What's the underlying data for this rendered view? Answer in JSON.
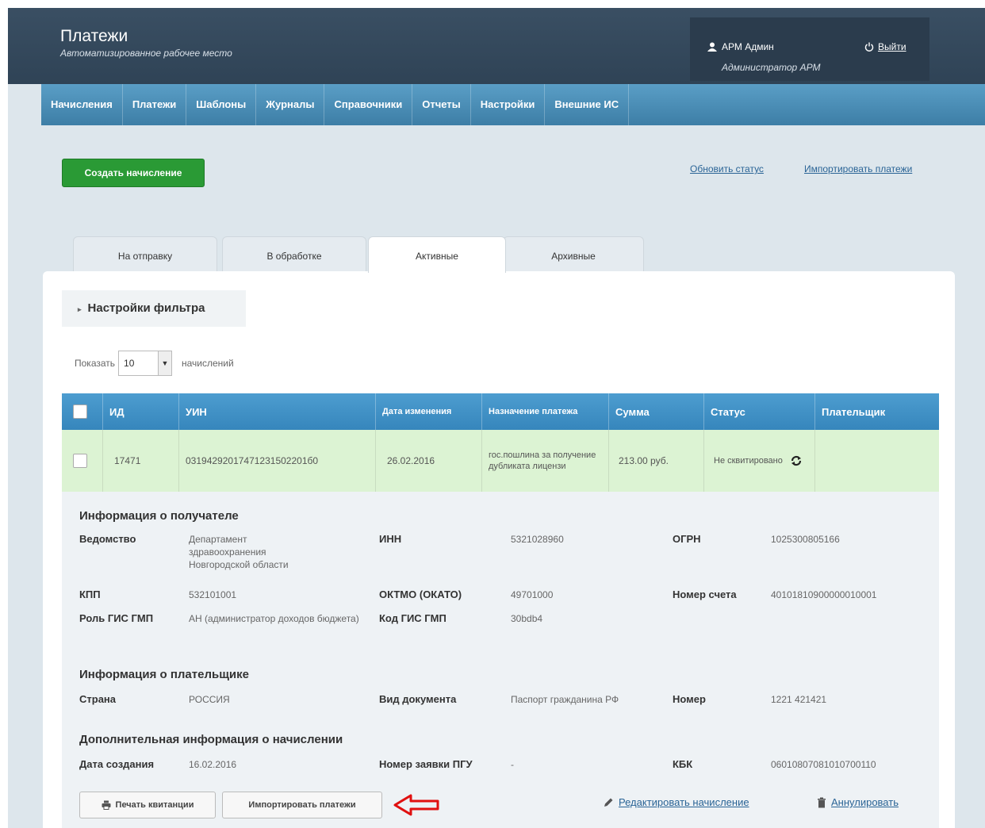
{
  "header": {
    "title": "Платежи",
    "subtitle": "Автоматизированное рабочее место",
    "user_name": "АРМ Админ",
    "user_role": "Администратор АРМ",
    "logout_label": "Выйти"
  },
  "nav": [
    "Начисления",
    "Платежи",
    "Шаблоны",
    "Журналы",
    "Справочники",
    "Отчеты",
    "Настройки",
    "Внешние ИС"
  ],
  "toolbar": {
    "create_label": "Создать начисление",
    "refresh_status_label": "Обновить статус",
    "import_payments_label": "Импортировать платежи"
  },
  "tabs": [
    {
      "label": "На отправку",
      "active": false
    },
    {
      "label": "В обработке",
      "active": false
    },
    {
      "label": "Активные",
      "active": true
    },
    {
      "label": "Архивные",
      "active": false
    }
  ],
  "filter": {
    "label": "Настройки фильтра"
  },
  "page_size": {
    "prefix": "Показать",
    "value": "10",
    "suffix": "начислений"
  },
  "table": {
    "columns": [
      "ИД",
      "УИН",
      "Дата изменения",
      "Назначение платежа",
      "Сумма",
      "Статус",
      "Плательщик"
    ],
    "rows": [
      {
        "id": "17471",
        "uin": "03194292017471231502201б0",
        "date": "26.02.2016",
        "purpose": "гос.пошлина за получение дубликата лицензи",
        "amount": "213.00 руб.",
        "status": "Не сквитировано",
        "payer": ""
      }
    ]
  },
  "recipient": {
    "title": "Информация о получателе",
    "labels": {
      "department": "Ведомство",
      "inn": "ИНН",
      "ogrn": "ОГРН",
      "kpp": "КПП",
      "oktmo": "ОКТМО (ОКАТО)",
      "account": "Номер счета",
      "role": "Роль ГИС ГМП",
      "gis_code": "Код ГИС ГМП"
    },
    "values": {
      "department": "Департамент здравоохранения Новгородской области",
      "inn": "5321028960",
      "ogrn": "1025300805166",
      "kpp": "532101001",
      "oktmo": "49701000",
      "account": "40101810900000010001",
      "role": "АН (администратор доходов бюджета)",
      "gis_code": "30bdb4"
    }
  },
  "payer": {
    "title": "Информация о плательщике",
    "labels": {
      "country": "Страна",
      "doc_type": "Вид документа",
      "number": "Номер"
    },
    "values": {
      "country": "РОССИЯ",
      "doc_type": "Паспорт гражданина РФ",
      "number": "1221 421421"
    }
  },
  "additional": {
    "title": "Дополнительная информация о начислении",
    "labels": {
      "created": "Дата создания",
      "pgu": "Номер заявки ПГУ",
      "kbk": "КБК"
    },
    "values": {
      "created": "16.02.2016",
      "pgu": "-",
      "kbk": "06010807081010700110"
    }
  },
  "actions": {
    "print_label": "Печать квитанции",
    "import_label": "Импортировать платежи",
    "edit_label": "Редактировать начисление",
    "cancel_label": "Аннулировать"
  },
  "colors": {
    "topbar": "#33475a",
    "nav": "#4a8fb8",
    "create_button": "#2a9a35",
    "table_header": "#3f8fc4",
    "active_row": "#dcf3d3",
    "arrow": "#e01010"
  }
}
